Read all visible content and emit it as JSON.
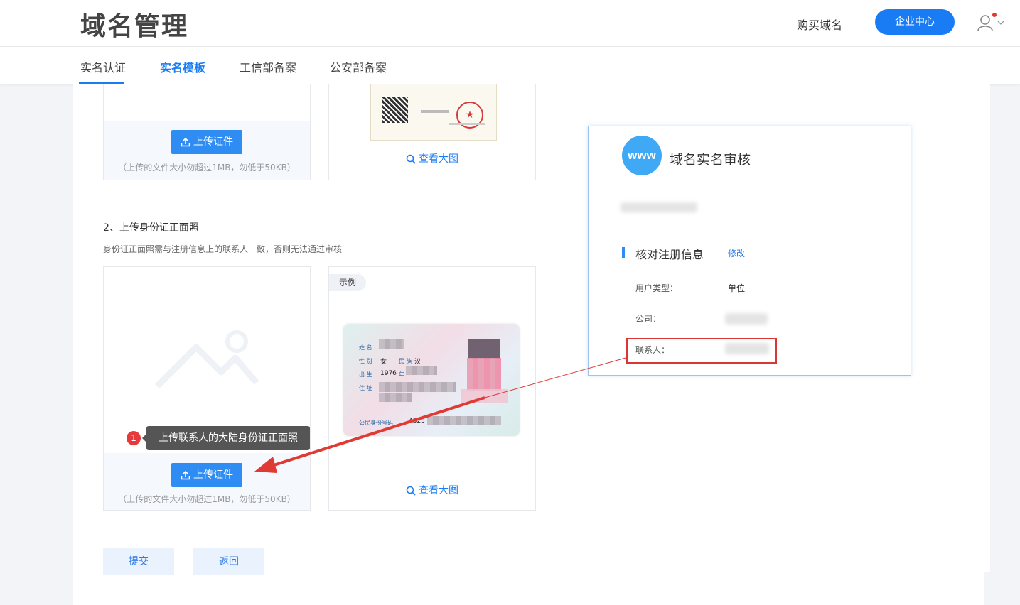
{
  "header": {
    "title": "域名管理",
    "buy_domain": "购买域名",
    "enterprise_center": "企业中心"
  },
  "tabs": [
    {
      "label": "实名认证",
      "active": false
    },
    {
      "label": "实名模板",
      "active": true
    },
    {
      "label": "工信部备案",
      "active": false
    },
    {
      "label": "公安部备案",
      "active": false
    }
  ],
  "section1": {
    "upload_label": "上传证件",
    "upload_note": "（上传的文件大小勿超过1MB，勿低于50KB）",
    "view_large": "查看大图"
  },
  "section2": {
    "title": "2、上传身份证正面照",
    "desc": "身份证正面照需与注册信息上的联系人一致，否则无法通过审核",
    "example_tag": "示例",
    "tooltip_number": "1",
    "tooltip": "上传联系人的大陆身份证正面照",
    "upload_label": "上传证件",
    "upload_note": "（上传的文件大小勿超过1MB，勿低于50KB）",
    "view_large": "查看大图",
    "id_card": {
      "name_label": "姓 名",
      "gender_label": "性 别",
      "gender_value": "女",
      "ethnic_label": "民 族",
      "ethnic_value": "汉",
      "birth_label": "出 生",
      "birth_year": "1976",
      "birth_year_unit": "年",
      "address_label": "住 址",
      "id_label": "公民身份号码",
      "id_prefix": "4323"
    }
  },
  "actions": {
    "submit": "提交",
    "back": "返回"
  },
  "popup": {
    "logo_text": "www",
    "title": "域名实名审核",
    "verify_title": "核对注册信息",
    "edit": "修改",
    "user_type_label": "用户类型：",
    "user_type_value": "单位",
    "company_label": "公司：",
    "contact_label": "联系人："
  },
  "colors": {
    "accent": "#1a7cf4",
    "highlight_box": "#d93636",
    "arrow": "#e03a35"
  }
}
